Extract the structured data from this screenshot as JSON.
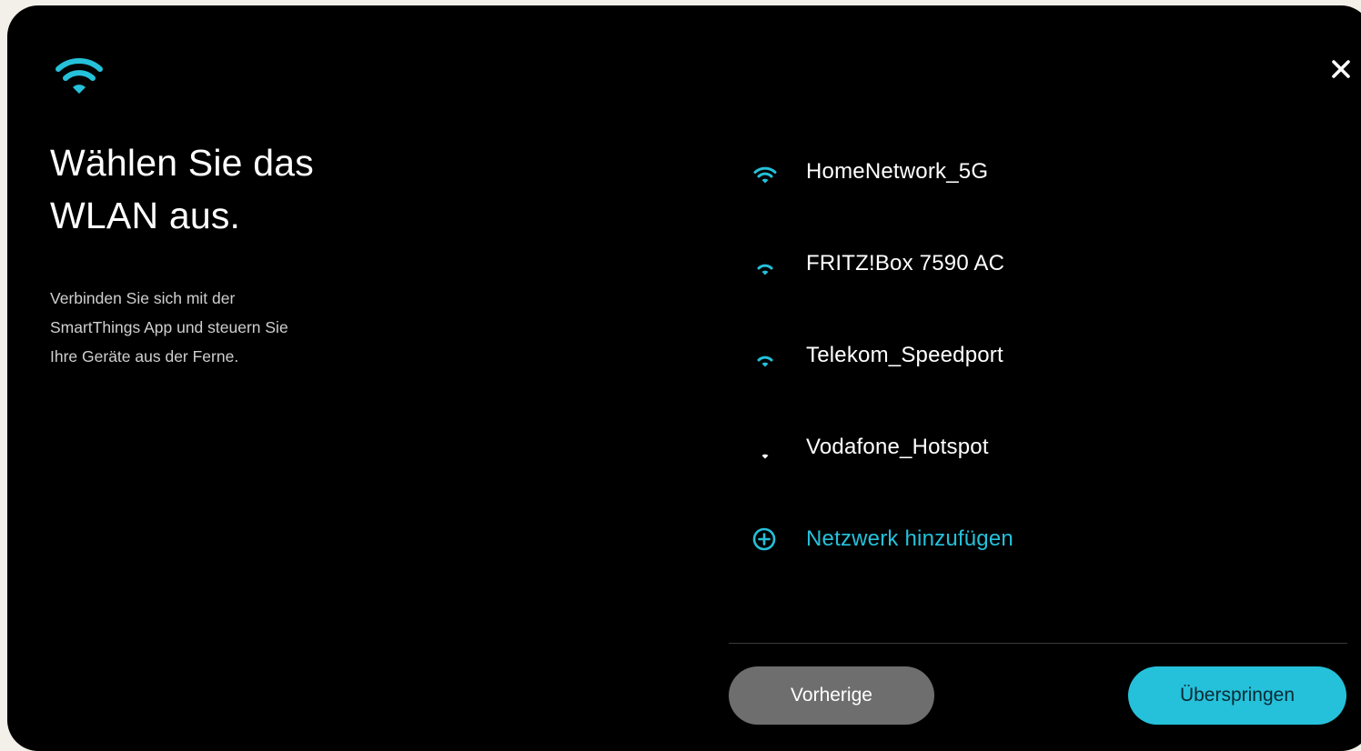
{
  "header": {
    "icon": "wifi-icon",
    "close_icon": "close-icon",
    "accent_color": "#25c1da"
  },
  "main": {
    "title_line1": "Wählen Sie das",
    "title_line2": "WLAN aus.",
    "subtitle_line1": "Verbinden Sie sich mit der",
    "subtitle_line2": "SmartThings App und steuern Sie",
    "subtitle_line3": "Ihre Geräte aus der Ferne."
  },
  "networks": [
    {
      "name": "HomeNetwork_5G",
      "signal_bars": 3,
      "icon": "wifi-signal-3-icon"
    },
    {
      "name": "FRITZ!Box 7590 AC",
      "signal_bars": 2,
      "icon": "wifi-signal-2-icon"
    },
    {
      "name": "Telekom_Speedport",
      "signal_bars": 2,
      "icon": "wifi-signal-2-icon"
    },
    {
      "name": "Vodafone_Hotspot",
      "signal_bars": 1,
      "icon": "wifi-signal-1-icon"
    }
  ],
  "add_network": {
    "label": "Netzwerk hinzufügen",
    "icon": "add-circle-icon"
  },
  "footer": {
    "prev_label": "Vorherige",
    "skip_label": "Überspringen"
  }
}
